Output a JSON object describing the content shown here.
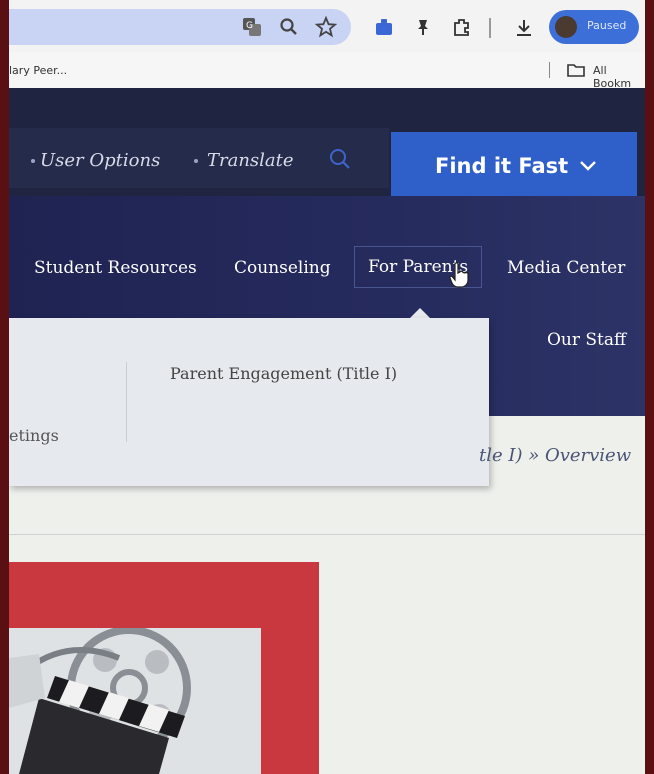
{
  "browser": {
    "profile_label": "Paused",
    "bookmark_left": "lary Peer...",
    "bookmark_right": "All Bookm",
    "icons": [
      "translate-icon",
      "zoom-icon",
      "star-icon",
      "extension-icon",
      "pin-icon",
      "puzzle-icon",
      "download-icon"
    ]
  },
  "header": {
    "user_options": "User Options",
    "translate": "Translate",
    "find_it_fast": "Find it Fast"
  },
  "nav": {
    "items": [
      "Student Resources",
      "Counseling",
      "For Parents",
      "Media Center",
      "Our Staff"
    ],
    "active_index": 2
  },
  "dropdown": {
    "left_item": "etings",
    "right_item": "Parent Engagement (Title I)"
  },
  "breadcrumb": {
    "text": "tle I) » ",
    "current": "Overview"
  },
  "colors": {
    "nav_bg": "#1f2352",
    "find_fast_bg": "#2f5fc8",
    "image_frame": "#c9383f"
  }
}
